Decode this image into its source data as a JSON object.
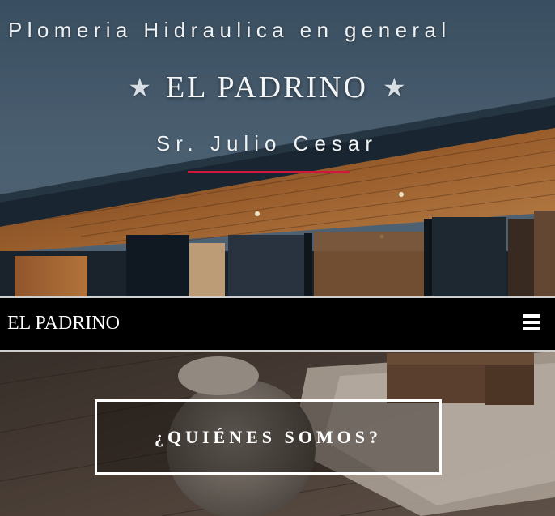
{
  "hero": {
    "tagline": "Plomeria Hidraulica en general",
    "star_left": "★",
    "brand": "EL PADRINO",
    "star_right": "★",
    "owner": "Sr. Julio Cesar",
    "rule_color": "#d0193a"
  },
  "navbar": {
    "brand": "EL PADRINO",
    "menu_icon": "hamburger-menu-icon"
  },
  "about": {
    "button_label": "¿QUIÉNES SOMOS?"
  },
  "colors": {
    "navbar_bg": "#000000",
    "accent": "#d0193a",
    "text": "#ffffff"
  }
}
